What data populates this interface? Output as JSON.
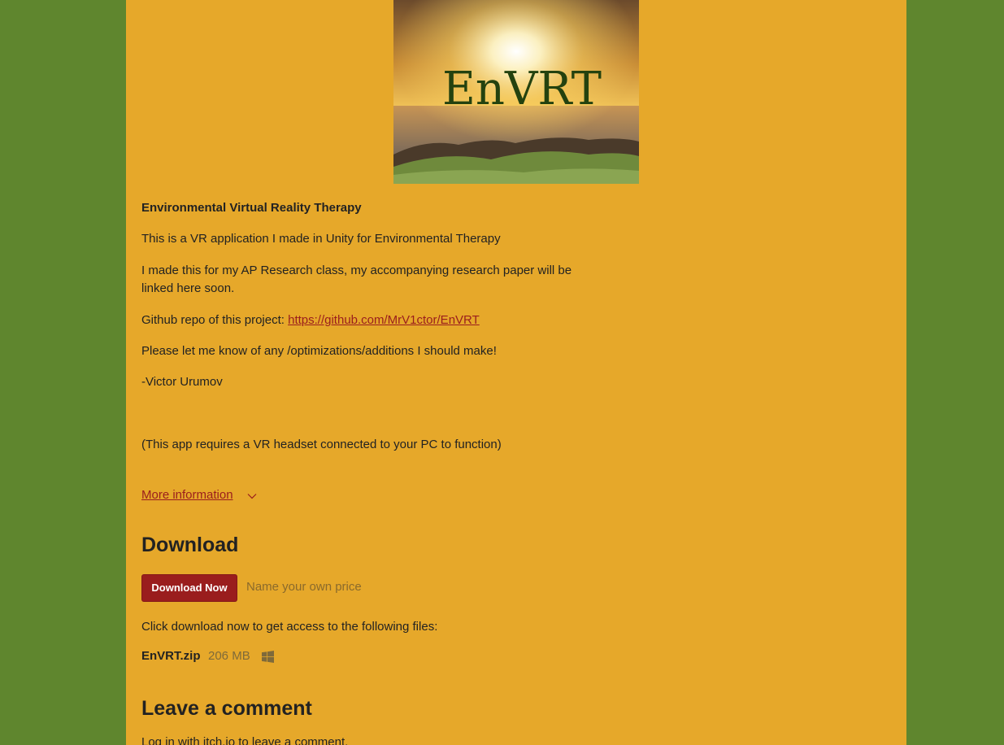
{
  "cover": {
    "logo_text": "EnVRT"
  },
  "description": {
    "title": "Environmental Virtual Reality Therapy",
    "line1": "This is a VR application I made in Unity for Environmental Therapy",
    "line2a": "I made this for my AP Research class, my accompanying research paper will be",
    "line2b": "linked here soon.",
    "github_prefix": "Github repo of this project: ",
    "github_link": "https://github.com/MrV1ctor/EnVRT",
    "line4": "Please let me know of any /optimizations/additions I should make!",
    "signature": "-Victor Urumov",
    "requirement": "(This app requires a VR headset connected to your PC to function)"
  },
  "more_information": "More information",
  "download": {
    "heading": "Download",
    "button_label": "Download Now",
    "price_text": "Name your own price",
    "instructions": "Click download now to get access to the following files:",
    "files": [
      {
        "name": "EnVRT.zip",
        "size": "206 MB",
        "platform_icon": "windows-icon"
      }
    ]
  },
  "comments": {
    "heading": "Leave a comment",
    "login_text": "Log in with itch.io to leave a comment."
  },
  "colors": {
    "background": "#5f862e",
    "page": "#e6a82a",
    "accent": "#9a1d1d",
    "text": "#222222"
  }
}
